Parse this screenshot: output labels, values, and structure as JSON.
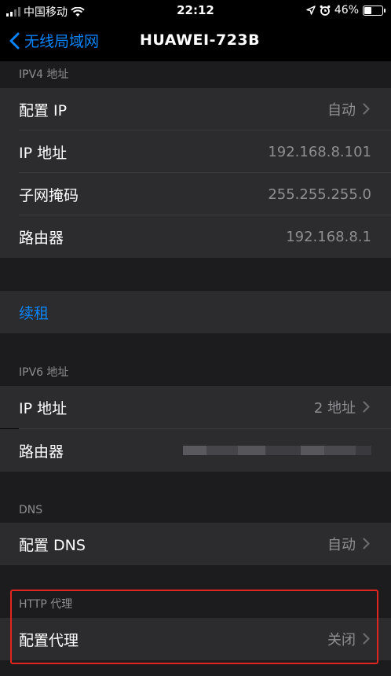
{
  "status_bar": {
    "carrier": "中国移动",
    "time": "22:12",
    "battery": "46%",
    "battery_level": 0.46
  },
  "nav": {
    "back_label": "无线局域网",
    "title": "HUAWEI-723B"
  },
  "ipv4": {
    "header": "IPV4 地址",
    "rows": [
      {
        "label": "配置 IP",
        "value": "自动"
      },
      {
        "label": "IP 地址",
        "value": "192.168.8.101"
      },
      {
        "label": "子网掩码",
        "value": "255.255.255.0"
      },
      {
        "label": "路由器",
        "value": "192.168.8.1"
      }
    ]
  },
  "renew": {
    "label": "续租"
  },
  "ipv6": {
    "header": "IPV6 地址",
    "rows": [
      {
        "label": "IP 地址",
        "value": "2 地址"
      },
      {
        "label": "路由器"
      }
    ]
  },
  "dns": {
    "header": "DNS",
    "rows": [
      {
        "label": "配置 DNS",
        "value": "自动"
      }
    ]
  },
  "http_proxy": {
    "header": "HTTP 代理",
    "rows": [
      {
        "label": "配置代理",
        "value": "关闭"
      }
    ]
  },
  "colors": {
    "accent": "#0a84ff",
    "highlight": "#e0261e",
    "cell": "#2c2c2e",
    "grouped_bg": "#1c1c1e"
  },
  "icons": [
    "signal-bars-icon",
    "wifi-icon",
    "location-icon",
    "alarm-icon",
    "battery-icon",
    "chevron-left-icon",
    "chevron-right-icon"
  ]
}
